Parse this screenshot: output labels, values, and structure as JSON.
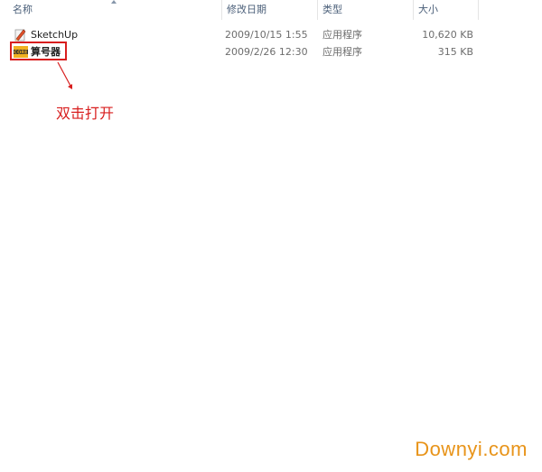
{
  "columns": {
    "name": "名称",
    "date_modified": "修改日期",
    "type": "类型",
    "size": "大小"
  },
  "files": [
    {
      "name": "SketchUp",
      "date_modified": "2009/10/15 1:55",
      "type": "应用程序",
      "size": "10,620 KB",
      "icon": "sketchup-app-icon"
    },
    {
      "name": "算号器",
      "date_modified": "2009/2/26 12:30",
      "type": "应用程序",
      "size": "315 KB",
      "icon": "keygen-app-icon"
    }
  ],
  "annotation": {
    "label": "双击打开",
    "color": "#d81e1e"
  },
  "watermark": {
    "text": "Downyi.com",
    "color": "#e8941a"
  }
}
